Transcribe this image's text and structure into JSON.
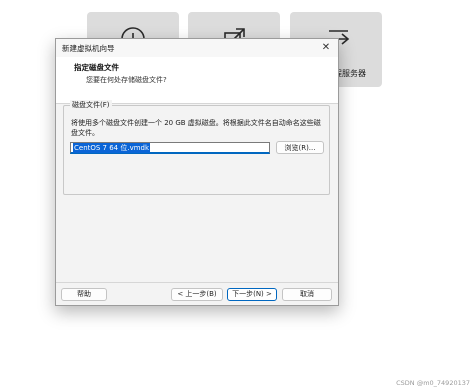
{
  "background_tiles": [
    {
      "icon": "plus-circle-icon",
      "label": ""
    },
    {
      "icon": "external-open-icon",
      "label": ""
    },
    {
      "icon": "connect-arrow-icon",
      "label": "程服务器"
    }
  ],
  "dialog": {
    "title": "新建虚拟机向导",
    "close_symbol": "✕",
    "header_title": "指定磁盘文件",
    "header_subtitle": "您要在何处存储磁盘文件?",
    "group_label": "磁盘文件(F)",
    "description": "将使用多个磁盘文件创建一个 20 GB 虚拟磁盘。将根据此文件名自动命名这些磁盘文件。",
    "filename_value": "CentOS 7 64 位.vmdk",
    "browse_label": "浏览(R)...",
    "buttons": {
      "help": "帮助",
      "back": "< 上一步(B)",
      "next": "下一步(N) >",
      "cancel": "取消"
    }
  },
  "watermark": "CSDN @m0_74920137",
  "colors": {
    "tile": "#dcdcdc",
    "dialog_bg": "#f3f3f3",
    "selection": "#0a64d6",
    "focus_border": "#0067c0"
  }
}
